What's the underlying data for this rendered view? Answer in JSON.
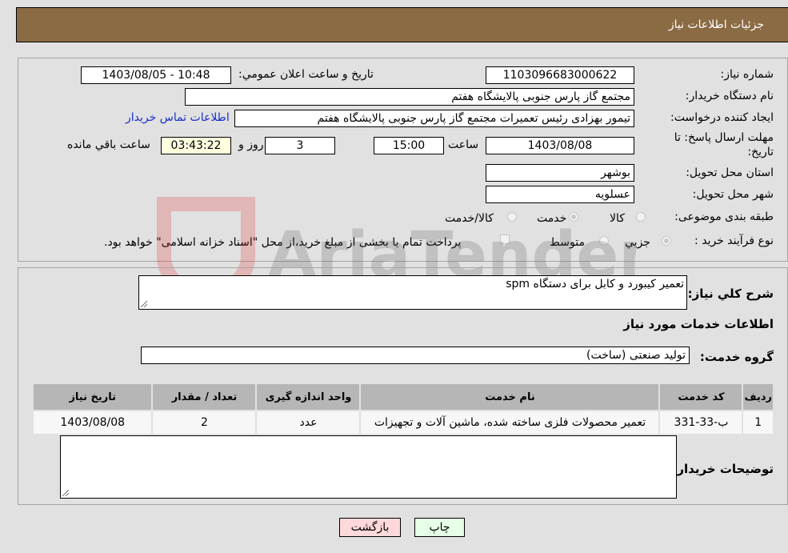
{
  "header": {
    "title": "جزئیات اطلاعات نیاز"
  },
  "form": {
    "need_number": {
      "label": "شماره نیاز:",
      "value": "1103096683000622"
    },
    "announce_datetime": {
      "label": "تاریخ و ساعت اعلان عمومي:",
      "value": "1403/08/05 - 10:48"
    },
    "buyer_org": {
      "label": "نام دستگاه خریدار:",
      "value": "مجتمع گاز پارس جنوبی  پالایشگاه هفتم"
    },
    "requester": {
      "label": "ایجاد کننده درخواست:",
      "value": "تیمور بهزادی رئیس تعمیرات مجتمع گاز پارس جنوبی  پالایشگاه هفتم"
    },
    "buyer_contact_link": "اطلاعات تماس خریدار",
    "deadline": {
      "label_line1": "مهلت ارسال پاسخ: تا",
      "label_line2": "تاریخ:",
      "date": "1403/08/08",
      "time_label": "ساعت",
      "time": "15:00",
      "days": "3",
      "days_label": "روز و",
      "remaining": "03:43:22",
      "remaining_label": "ساعت باقي مانده"
    },
    "province": {
      "label": "استان محل تحویل:",
      "value": "بوشهر"
    },
    "city": {
      "label": "شهر محل تحویل:",
      "value": "عسلویه"
    },
    "category": {
      "label": "طبقه بندی موضوعی:",
      "options": [
        "کالا",
        "خدمت",
        "کالا/خدمت"
      ],
      "selected": "خدمت"
    },
    "purchase_type": {
      "label": "نوع فرآیند خرید :",
      "options": [
        "جزيي",
        "متوسط"
      ],
      "selected": "جزيي",
      "treasury_note": "پرداخت تمام یا بخشی از مبلغ خرید،از محل \"اسناد خزانه اسلامی\" خواهد بود."
    }
  },
  "details": {
    "summary_label": "شرح کلي نياز:",
    "summary_value": "تعمیر کیبورد و کابل برای دستگاه spm",
    "services_heading": "اطلاعات خدمات مورد نیاز",
    "service_group_label": "گروه خدمت:",
    "service_group_value": "تولید صنعتی (ساخت)",
    "table": {
      "headers": [
        "ردیف",
        "کد خدمت",
        "نام خدمت",
        "واحد اندازه گیری",
        "تعداد / مقدار",
        "تاریخ نیاز"
      ],
      "rows": [
        [
          "1",
          "ب-33-331",
          "تعمیر محصولات فلزی ساخته شده، ماشین آلات و تجهیزات",
          "عدد",
          "2",
          "1403/08/08"
        ]
      ]
    },
    "buyer_notes_label": "توضیحات خریدار:",
    "buyer_notes_value": ""
  },
  "buttons": {
    "print": "چاپ",
    "back": "بازگشت"
  },
  "watermark": "AriaTender.neT",
  "colors": {
    "title_bg": "#8b6b43",
    "back_btn": "#ffd9d9",
    "print_btn": "#e6ffe6",
    "link": "#1a2ec8"
  }
}
